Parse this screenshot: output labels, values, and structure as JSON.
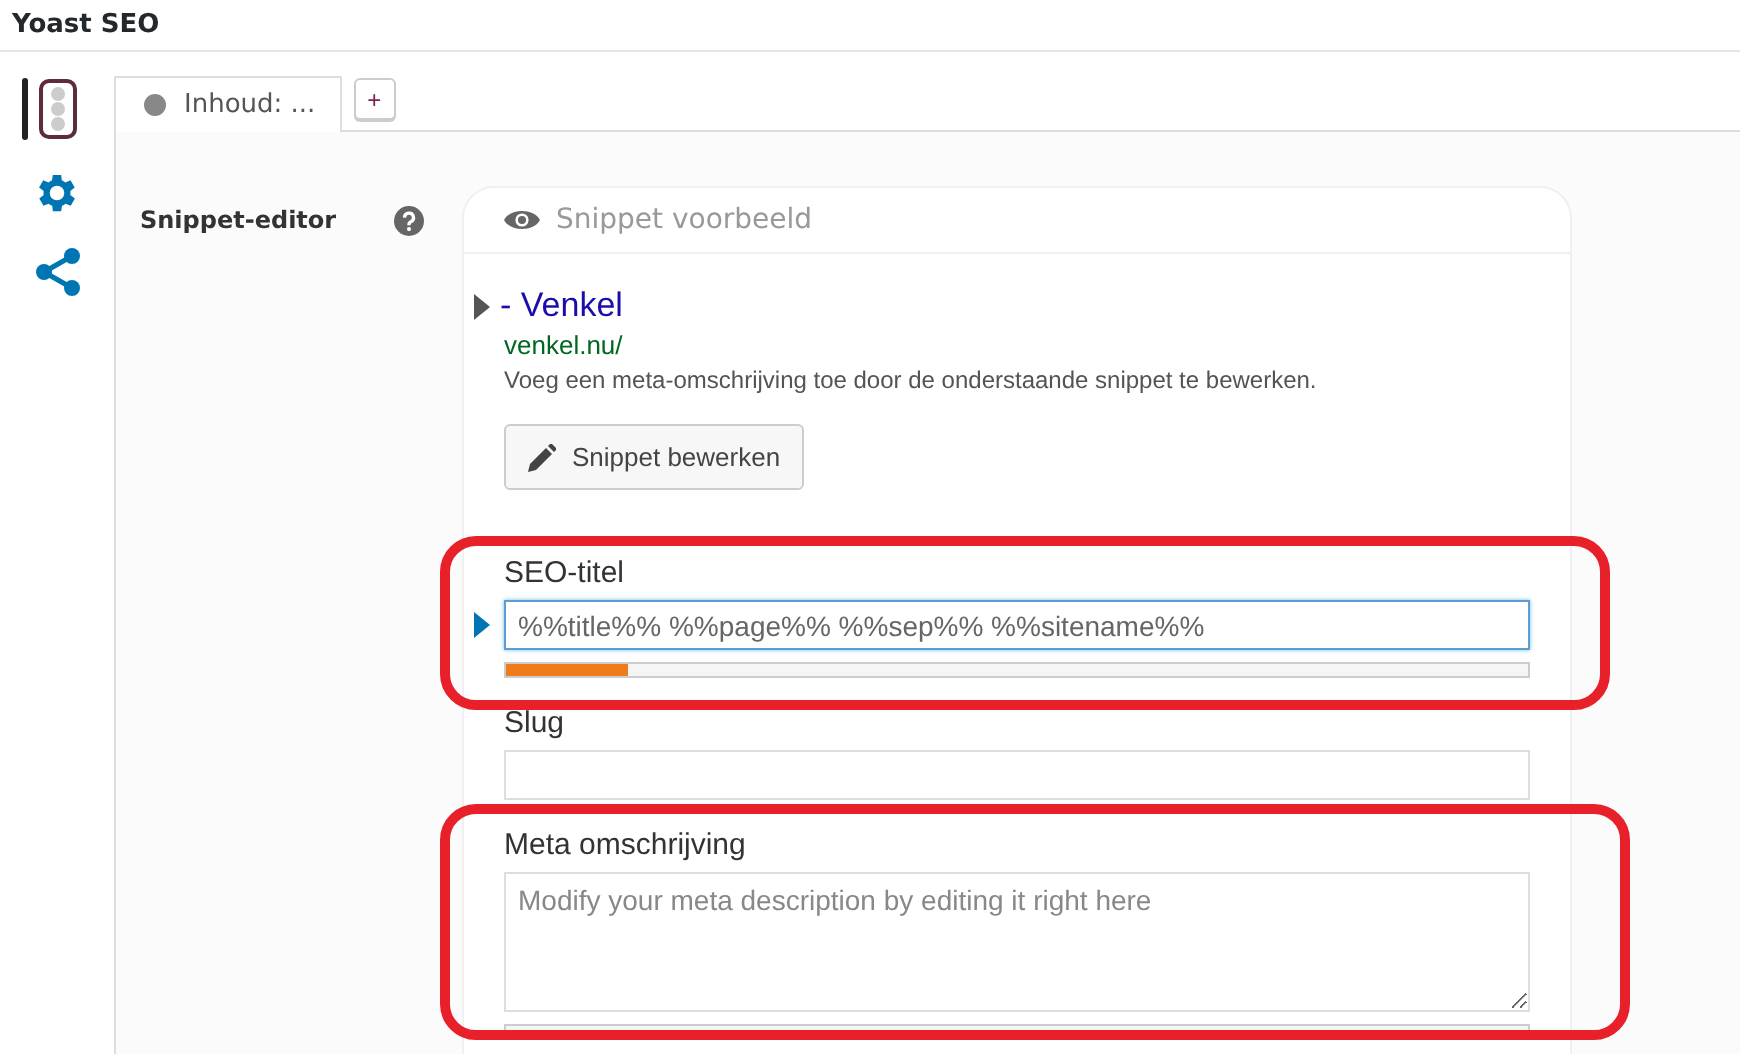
{
  "app_title": "Yoast SEO",
  "side_tabs": [
    {
      "kind": "readability",
      "selected": true
    },
    {
      "kind": "settings",
      "selected": false
    },
    {
      "kind": "social",
      "selected": false
    }
  ],
  "tabs": [
    {
      "label": "Inhoud: ...",
      "selected": true
    }
  ],
  "add_tab_button": "+",
  "snippet_editor": {
    "label": "Snippet-editor",
    "preview": {
      "heading": "Snippet voorbeeld",
      "title": "- Venkel",
      "url": "venkel.nu/",
      "description": "Voeg een meta-omschrijving toe door de onderstaande snippet te bewerken.",
      "edit_button": "Snippet bewerken"
    },
    "fields": [
      {
        "kind": "input",
        "label": "SEO-titel",
        "value": "%%title%% %%page%% %%sep%% %%sitename%%",
        "focused": true,
        "level": 0.12
      },
      {
        "kind": "input",
        "label": "Slug",
        "focused": false
      },
      {
        "kind": "textarea",
        "label": "Meta omschrijving",
        "placeholder": "Modify your meta description by editing it right here",
        "focused": false
      }
    ]
  }
}
